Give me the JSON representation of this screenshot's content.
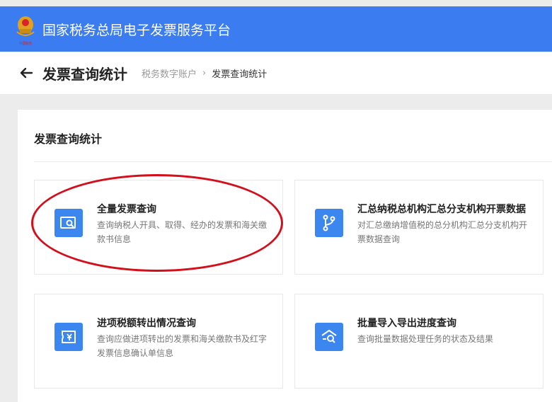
{
  "app": {
    "title": "国家税务总局电子发票服务平台",
    "emblem_text": "中国税务"
  },
  "header": {
    "page_title": "发票查询统计",
    "breadcrumb": [
      "税务数字账户",
      "发票查询统计"
    ],
    "breadcrumb_separator": "›"
  },
  "panel": {
    "title": "发票查询统计"
  },
  "cards": [
    {
      "title": "全量发票查询",
      "desc": "查询纳税人开具、取得、经办的发票和海关缴款书信息",
      "icon": "invoice-search-icon"
    },
    {
      "title": "汇总纳税总机构汇总分支机构开票数据",
      "desc": "对汇总缴纳增值税的总分机构汇总分支机构开票数据查询",
      "icon": "branch-icon"
    },
    {
      "title": "进项税额转出情况查询",
      "desc": "查询应做进项转出的发票和海关缴款书及红字发票信息确认单信息",
      "icon": "yen-ticket-icon"
    },
    {
      "title": "批量导入导出进度查询",
      "desc": "查询批量数据处理任务的状态及结果",
      "icon": "batch-search-icon"
    }
  ],
  "colors": {
    "topbar": "#3b7cf0",
    "icon_bg": "#3b86ef",
    "annotation": "#d40f1c"
  }
}
